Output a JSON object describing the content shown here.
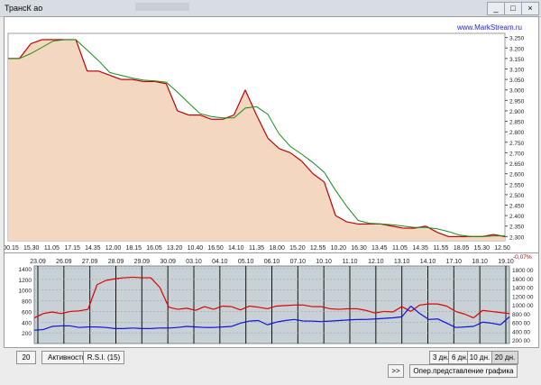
{
  "window": {
    "title": "ТрансК ао",
    "minimize": "_",
    "maximize": "□",
    "close": "×"
  },
  "watermark": "www.MarkStream.ru",
  "price_axis": [
    "3.250",
    "3.200",
    "3.150",
    "3.100",
    "3.050",
    "3.000",
    "2.950",
    "2.900",
    "2.850",
    "2.800",
    "2.750",
    "2.700",
    "2.650",
    "2.600",
    "2.550",
    "2.500",
    "2.450",
    "2.400",
    "2.350",
    "2.300"
  ],
  "time_axis": [
    "00.15",
    "15.30",
    "11.05",
    "17.15",
    "14.35",
    "12.00",
    "18.15",
    "16.05",
    "13.20",
    "10.40",
    "16.50",
    "14.10",
    "11.35",
    "18.00",
    "15.20",
    "12.55",
    "10.20",
    "16.30",
    "13.45",
    "11.05",
    "14.35",
    "11.55",
    "18.05",
    "15.30",
    "12.50"
  ],
  "change_label": "-0,07%",
  "date_axis": [
    "23.09",
    "26.09",
    "27.09",
    "28.09",
    "29.09",
    "30.09",
    "03.10",
    "04.10",
    "05.10",
    "06.10",
    "07.10",
    "10.10",
    "11.10",
    "12.10",
    "13.10",
    "14.10",
    "17.10",
    "18.10",
    "19.10"
  ],
  "volume_axis_left": [
    "1400",
    "1200",
    "1000",
    "800",
    "600",
    "400",
    "200"
  ],
  "volume_axis_right": [
    "1800 00",
    "1600 00",
    "1400 00",
    "1200 00",
    "1000 00",
    "800 00",
    "600 00",
    "400 00",
    "200 00"
  ],
  "controls": {
    "period_value": "20",
    "activity": "Активность",
    "rsi": "R.S.I.  (15)",
    "scroll": ">>",
    "range_3": "3 дн.",
    "range_6": "6 дн.",
    "range_10": "10 дн.",
    "range_20": "20 дн.",
    "selected_range": "20 дн.",
    "oper_view": "Опер.представление графика"
  },
  "colors": {
    "area_fill": "#f4d7c0",
    "price_line": "#c00000",
    "ma_line": "#1b8a1b",
    "volume_red": "#e00000",
    "volume_blue": "#1010e0",
    "bottom_bg": "#c8d1d6"
  },
  "chart_data": [
    {
      "type": "line",
      "ylim": [
        2.28,
        3.27
      ],
      "series": [
        {
          "values": [
            3.15,
            3.15,
            3.22,
            3.24,
            3.24,
            3.24,
            3.24,
            3.09,
            3.09,
            3.07,
            3.05,
            3.05,
            3.04,
            3.04,
            3.03,
            2.9,
            2.88,
            2.88,
            2.86,
            2.86,
            2.88,
            3.0,
            2.88,
            2.77,
            2.72,
            2.7,
            2.66,
            2.6,
            2.56,
            2.4,
            2.37,
            2.36,
            2.36,
            2.36,
            2.35,
            2.34,
            2.34,
            2.35,
            2.32,
            2.3,
            2.3,
            2.3,
            2.3,
            2.31,
            2.3
          ]
        }
      ]
    },
    {
      "type": "line",
      "ylim": [
        0,
        1450
      ],
      "series": [
        {
          "values": [
            480,
            560,
            590,
            560,
            600,
            610,
            640,
            1100,
            1180,
            1210,
            1230,
            1240,
            1230,
            1230,
            1050,
            680,
            640,
            660,
            620,
            690,
            640,
            700,
            690,
            630,
            700,
            680,
            650,
            700,
            710,
            720,
            720,
            690,
            690,
            650,
            640,
            650,
            650,
            620,
            570,
            600,
            590,
            690,
            600,
            720,
            740,
            740,
            700,
            600,
            550,
            480,
            620,
            600,
            580,
            560
          ]
        },
        {
          "values": [
            250,
            260,
            320,
            330,
            330,
            300,
            310,
            310,
            300,
            280,
            280,
            290,
            280,
            280,
            290,
            290,
            300,
            320,
            310,
            300,
            300,
            310,
            320,
            380,
            420,
            430,
            350,
            400,
            430,
            450,
            420,
            420,
            410,
            420,
            430,
            440,
            450,
            450,
            460,
            470,
            480,
            500,
            700,
            560,
            450,
            460,
            380,
            300,
            310,
            320,
            400,
            380,
            350,
            500
          ]
        }
      ]
    }
  ]
}
